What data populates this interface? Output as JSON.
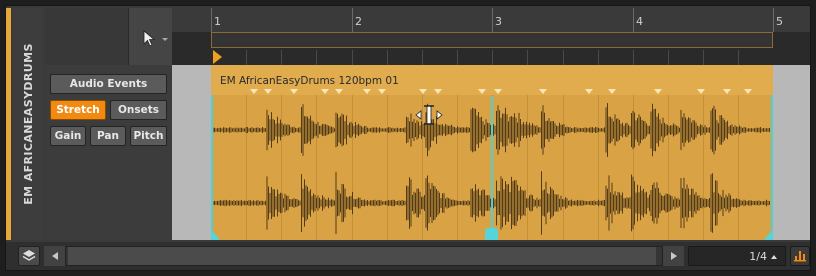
{
  "track": {
    "name": "EM AFRICANEASYDRUMS",
    "accent_color": "#e7a83a"
  },
  "toolbar": {
    "pointer_tool_icon": "pointer-icon"
  },
  "inspector": {
    "audio_events_label": "Audio Events",
    "stretch_label": "Stretch",
    "onsets_label": "Onsets",
    "gain_label": "Gain",
    "pan_label": "Pan",
    "pitch_label": "Pitch",
    "active_mode": "Stretch",
    "active_color": "#f08a10"
  },
  "ruler": {
    "bars": [
      "1",
      "2",
      "3",
      "4",
      "5"
    ]
  },
  "clip": {
    "title": "EM AfricanEasyDrums 120bpm 01",
    "color": "#d9a245",
    "marker_color": "#56d4da"
  },
  "footer": {
    "layers_icon": "layers-icon",
    "grid_value": "1/4",
    "snap_icon": "snap-icon"
  }
}
